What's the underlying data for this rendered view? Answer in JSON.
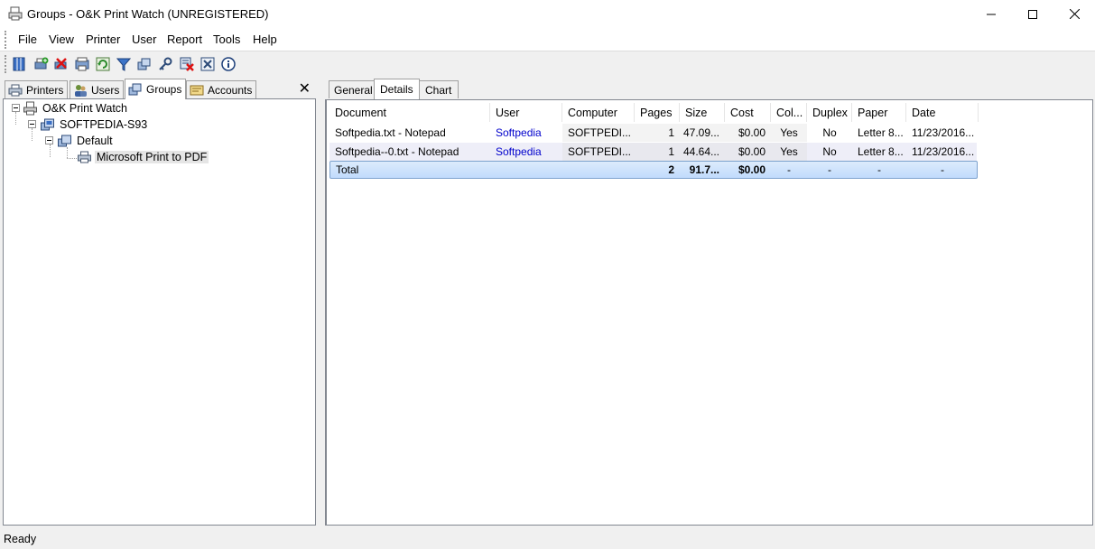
{
  "window": {
    "title": "Groups - O&K Print Watch (UNREGISTERED)",
    "controls": [
      "minimize",
      "maximize",
      "close"
    ]
  },
  "menu": [
    "File",
    "View",
    "Printer",
    "User",
    "Report",
    "Tools",
    "Help"
  ],
  "toolbar": {
    "icons": [
      "panel-icon",
      "add-printer-icon",
      "delete-printer-icon",
      "printer-list-icon",
      "refresh-icon",
      "filter-icon",
      "groups-icon",
      "key-icon",
      "remove-filter-icon",
      "report-icon",
      "info-icon"
    ]
  },
  "left_tabs": [
    {
      "label": "Printers",
      "icon": "printer-icon"
    },
    {
      "label": "Users",
      "icon": "users-icon"
    },
    {
      "label": "Groups",
      "icon": "groups-icon",
      "active": true
    },
    {
      "label": "Accounts",
      "icon": "accounts-icon"
    }
  ],
  "left_close": "✕",
  "tree": [
    {
      "label": "O&K Print Watch",
      "icon": "printwatch-icon"
    },
    {
      "label": "SOFTPEDIA-S93",
      "icon": "computer-icon"
    },
    {
      "label": "Default",
      "icon": "group-icon"
    },
    {
      "label": "Microsoft Print to PDF",
      "icon": "printer-icon",
      "selected": true
    }
  ],
  "right_tabs": [
    {
      "label": "General"
    },
    {
      "label": "Details",
      "active": true
    },
    {
      "label": "Chart"
    }
  ],
  "details": {
    "columns": [
      "Document",
      "User",
      "Computer",
      "Pages",
      "Size",
      "Cost",
      "Col...",
      "Duplex",
      "Paper",
      "Date"
    ],
    "rows": [
      {
        "document": "Softpedia.txt - Notepad",
        "user": "Softpedia",
        "computer": "SOFTPEDI...",
        "pages": "1",
        "size": "47.09...",
        "cost": "$0.00",
        "color": "Yes",
        "duplex": "No",
        "paper": "Letter 8...",
        "date": "11/23/2016..."
      },
      {
        "document": "Softpedia--0.txt - Notepad",
        "user": "Softpedia",
        "computer": "SOFTPEDI...",
        "pages": "1",
        "size": "44.64...",
        "cost": "$0.00",
        "color": "Yes",
        "duplex": "No",
        "paper": "Letter 8...",
        "date": "11/23/2016..."
      }
    ],
    "total": {
      "label": "Total",
      "pages": "2",
      "size": "91.7...",
      "cost": "$0.00",
      "color": "-",
      "duplex": "-",
      "paper": "-",
      "date": "-"
    }
  },
  "status": "Ready",
  "colors": {
    "user_link": "#0000cc",
    "selection": "#c1dbfc",
    "selection_border": "#7da2ce"
  }
}
